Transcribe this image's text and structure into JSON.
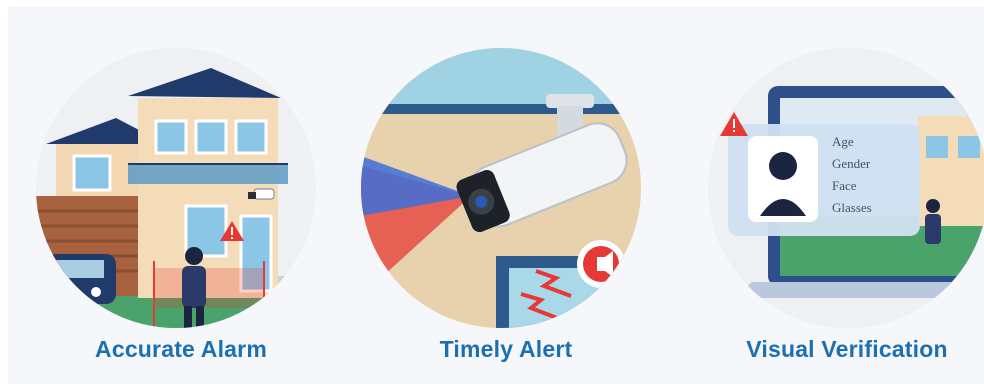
{
  "features": [
    {
      "title": "Accurate Alarm",
      "icon": "house-camera-illustration"
    },
    {
      "title": "Timely Alert",
      "icon": "bullet-camera-siren-illustration"
    },
    {
      "title": "Visual Verification",
      "icon": "laptop-face-recognition-illustration",
      "attributes": [
        "Age",
        "Gender",
        "Face",
        "Glasses"
      ]
    }
  ],
  "colors": {
    "caption": "#1d6fb4",
    "circle_bg": "#eef1f5",
    "alert_red": "#e53935",
    "navy": "#1f3a6b"
  }
}
